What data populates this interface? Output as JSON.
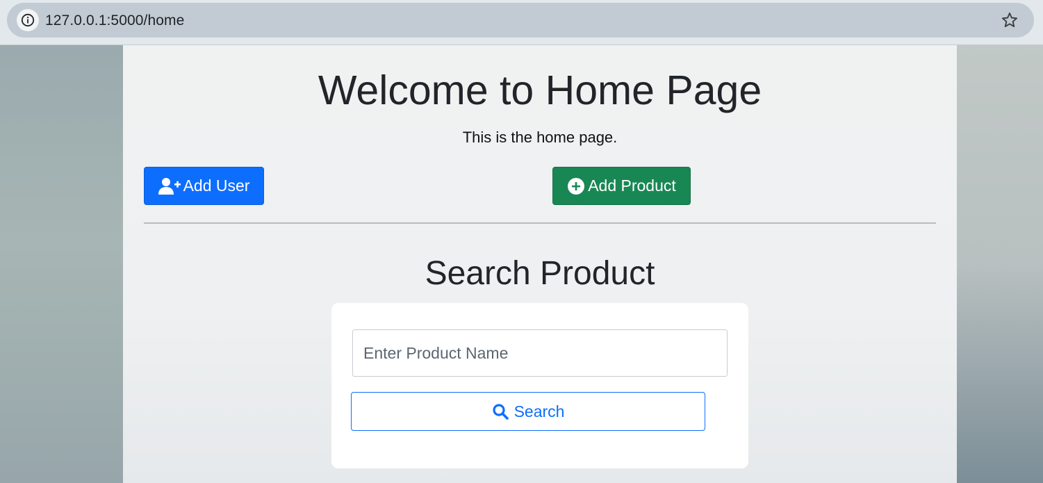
{
  "browser": {
    "url": "127.0.0.1:5000/home"
  },
  "page": {
    "title": "Welcome to Home Page",
    "subtitle": "This is the home page."
  },
  "actions": {
    "add_user_label": "Add User",
    "add_product_label": "Add Product"
  },
  "search": {
    "heading": "Search Product",
    "placeholder": "Enter Product Name",
    "value": "",
    "button_label": "Search"
  },
  "icons": {
    "info": "info-icon",
    "star": "star-icon",
    "add_user": "user-plus-icon",
    "add_product": "plus-circle-icon",
    "search": "search-icon"
  },
  "colors": {
    "primary": "#0d6efd",
    "success": "#198754"
  }
}
